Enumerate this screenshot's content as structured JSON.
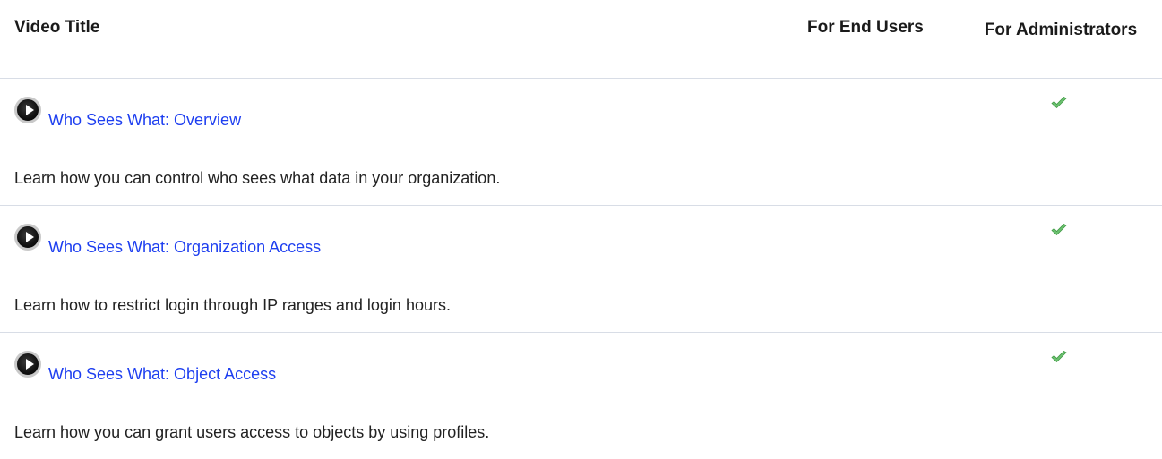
{
  "table": {
    "headers": {
      "video_title": "Video Title",
      "for_end_users": "For End Users",
      "for_administrators": "For Administrators"
    },
    "rows": [
      {
        "title": "Who Sees What: Overview",
        "description": "Learn how you can control who sees what data in your organization.",
        "for_end_users": false,
        "for_administrators": true
      },
      {
        "title": "Who Sees What: Organization Access",
        "description": "Learn how to restrict login through IP ranges and login hours.",
        "for_end_users": false,
        "for_administrators": true
      },
      {
        "title": "Who Sees What: Object Access",
        "description": "Learn how you can grant users access to objects by using profiles.",
        "for_end_users": false,
        "for_administrators": true
      }
    ]
  },
  "icons": {
    "play": "play-video-icon",
    "check": "checkmark-icon"
  },
  "colors": {
    "link": "#1e3ff0",
    "check": "#5cb85c",
    "divider": "#d8dde6"
  }
}
